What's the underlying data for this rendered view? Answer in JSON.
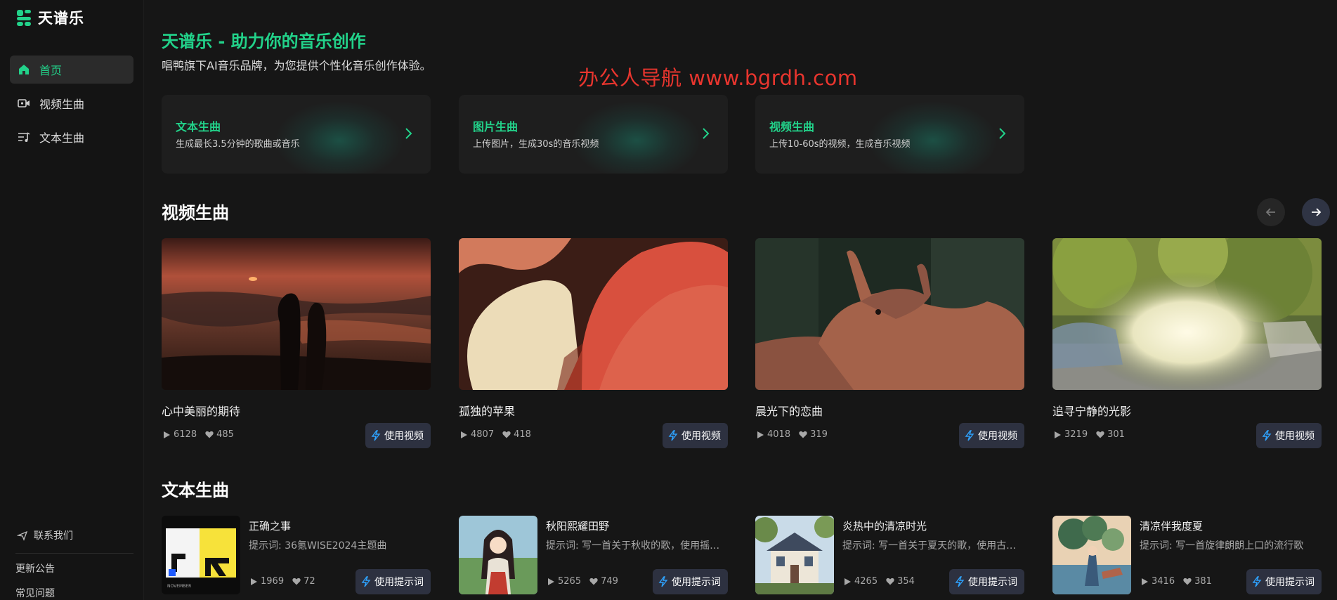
{
  "app": {
    "name": "天谱乐"
  },
  "sidebar": {
    "items": [
      {
        "label": "首页",
        "active": true
      },
      {
        "label": "视频生曲"
      },
      {
        "label": "文本生曲"
      }
    ],
    "contact": "联系我们",
    "links": [
      "更新公告",
      "常见问题"
    ]
  },
  "hero": {
    "title": "天谱乐 - 助力你的音乐创作",
    "subtitle": "唱鸭旗下AI音乐品牌，为您提供个性化音乐创作体验。"
  },
  "watermark": "办公人导航 www.bgrdh.com",
  "features": [
    {
      "title": "文本生曲",
      "desc": "生成最长3.5分钟的歌曲或音乐"
    },
    {
      "title": "图片生曲",
      "desc": "上传图片，生成30s的音乐视频"
    },
    {
      "title": "视频生曲",
      "desc": "上传10-60s的视频，生成音乐视频"
    }
  ],
  "video_section": {
    "title": "视频生曲",
    "cards": [
      {
        "title": "心中美丽的期待",
        "plays": "6128",
        "likes": "485",
        "button": "使用视频"
      },
      {
        "title": "孤独的苹果",
        "plays": "4807",
        "likes": "418",
        "button": "使用视频"
      },
      {
        "title": "晨光下的恋曲",
        "plays": "4018",
        "likes": "319",
        "button": "使用视频"
      },
      {
        "title": "追寻宁静的光影",
        "plays": "3219",
        "likes": "301",
        "button": "使用视频"
      }
    ]
  },
  "text_section": {
    "title": "文本生曲",
    "cards": [
      {
        "title": "正确之事",
        "desc": "提示词: 36氪WISE2024主题曲",
        "plays": "1969",
        "likes": "72",
        "button": "使用提示词",
        "cover_text": "正确的事"
      },
      {
        "title": "秋阳熙耀田野",
        "desc": "提示词: 写一首关于秋收的歌，使用摇滚...",
        "plays": "5265",
        "likes": "749",
        "button": "使用提示词"
      },
      {
        "title": "炎热中的清凉时光",
        "desc": "提示词: 写一首关于夏天的歌，使用古风...",
        "plays": "4265",
        "likes": "354",
        "button": "使用提示词"
      },
      {
        "title": "清凉伴我度夏",
        "desc": "提示词: 写一首旋律朗朗上口的流行歌",
        "plays": "3416",
        "likes": "381",
        "button": "使用提示词"
      }
    ]
  },
  "colors": {
    "accent": "#22d28a",
    "background": "#161616",
    "button": "#2d3140",
    "watermark": "#e8352e"
  }
}
